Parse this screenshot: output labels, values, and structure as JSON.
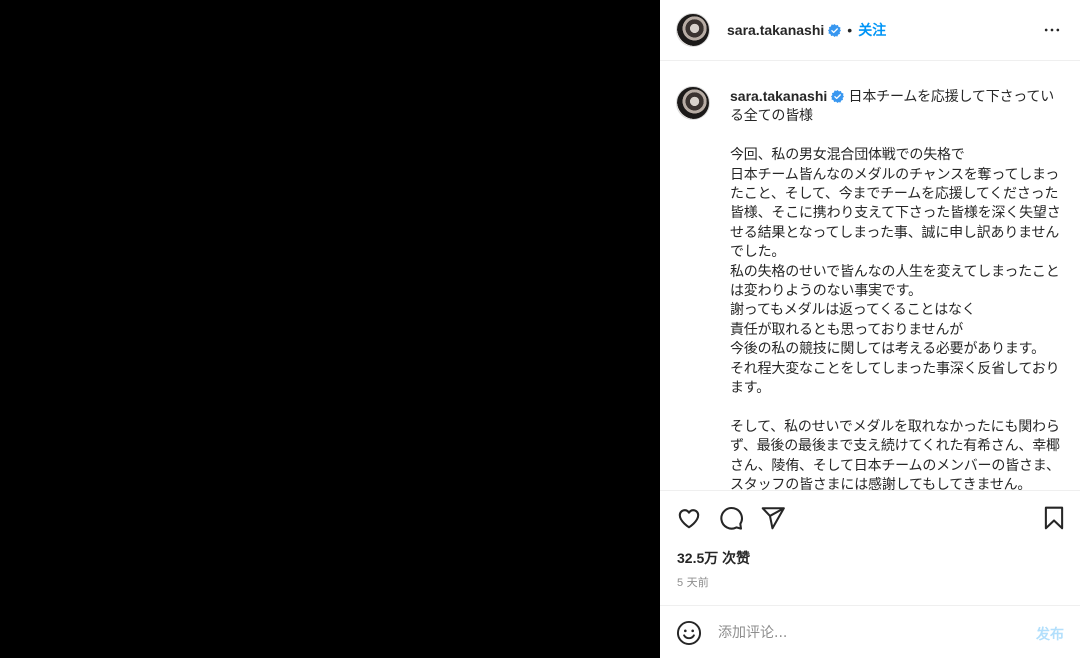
{
  "header": {
    "username": "sara.takanashi",
    "follow_label": "关注",
    "separator": "•"
  },
  "caption": {
    "username": "sara.takanashi",
    "text": " 日本チームを応援して下さっている全ての皆様\n\n今回、私の男女混合団体戦での失格で\n日本チーム皆んなのメダルのチャンスを奪ってしまったこと、そして、今までチームを応援してくださった皆様、そこに携わり支えて下さった皆様を深く失望させる結果となってしまった事、誠に申し訳ありませんでした。\n私の失格のせいで皆んなの人生を変えてしまったことは変わりようのない事実です。\n謝ってもメダルは返ってくることはなく\n責任が取れるとも思っておりませんが\n今後の私の競技に関しては考える必要があります。\nそれ程大変なことをしてしまった事深く反省しております。\n\nそして、私のせいでメダルを取れなかったにも関わらず、最後の最後まで支え続けてくれた有希さん、幸椰さん、陵侑、そして日本チームのメンバーの皆さま、スタッフの皆さまには感謝してもしてきません。"
  },
  "stats": {
    "likes": "32.5万 次赞",
    "time": "5 天前"
  },
  "comment": {
    "placeholder": "添加评论...",
    "post_label": "发布"
  },
  "colors": {
    "accent": "#0095f6",
    "post_disabled": "#b2dffc",
    "verified": "#3897f0"
  },
  "icons": [
    "more-icon",
    "verified-badge-icon",
    "like-heart-icon",
    "comment-icon",
    "share-icon",
    "save-bookmark-icon",
    "emoji-icon"
  ]
}
